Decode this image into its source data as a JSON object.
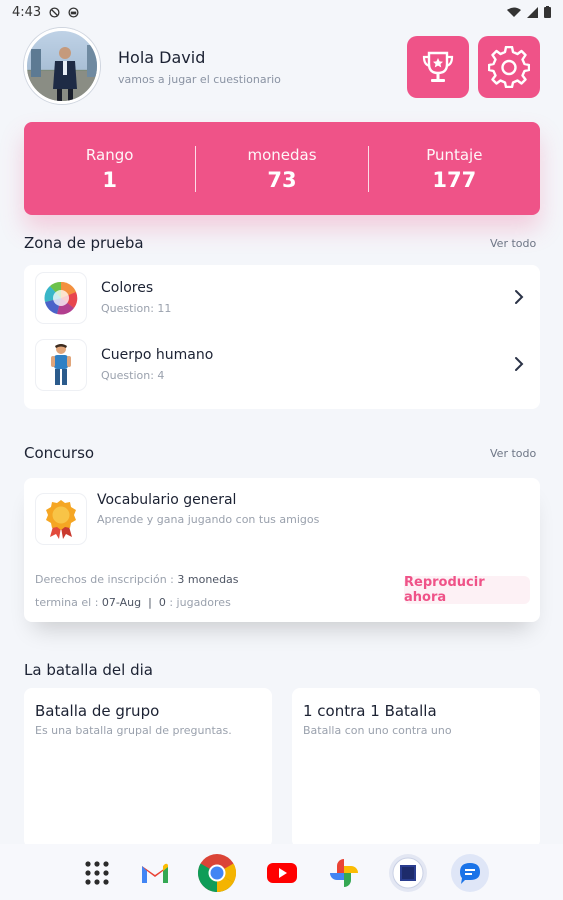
{
  "status_bar": {
    "time": "4:43"
  },
  "header": {
    "greeting": "Hola David",
    "subtitle": "vamos a jugar el cuestionario"
  },
  "stats": [
    {
      "label": "Rango",
      "value": "1"
    },
    {
      "label": "monedas",
      "value": "73"
    },
    {
      "label": "Puntaje",
      "value": "177"
    }
  ],
  "test_zone": {
    "title": "Zona de prueba",
    "see_all": "Ver todo",
    "items": [
      {
        "title": "Colores",
        "meta": "Question: 11",
        "icon": "color-wheel-icon"
      },
      {
        "title": "Cuerpo humano",
        "meta": "Question: 4",
        "icon": "human-figure-icon"
      }
    ]
  },
  "contest": {
    "title": "Concurso",
    "see_all": "Ver todo",
    "card": {
      "title": "Vocabulario general",
      "description": "Aprende y gana jugando con tus amigos",
      "fee_label": "Derechos de inscripción : ",
      "fee_value": "3 monedas",
      "ends_label": "termina el : ",
      "ends_value": "07-Aug",
      "separator": "|",
      "players_value": "0",
      "players_label": " : jugadores",
      "play_button": "Reproducir ahora"
    }
  },
  "battle": {
    "title": "La batalla del dia",
    "cards": [
      {
        "title": "Batalla de grupo",
        "description": "Es una batalla grupal de preguntas."
      },
      {
        "title": "1 contra 1 Batalla",
        "description": "Batalla con uno contra uno"
      }
    ]
  },
  "dock": {
    "apps": [
      "app-grid-icon",
      "gmail-icon",
      "chrome-icon",
      "youtube-icon",
      "photos-icon",
      "app-icon",
      "messages-icon"
    ]
  },
  "colors": {
    "accent": "#ef5388",
    "background": "#f4f6fa",
    "card": "#ffffff"
  }
}
